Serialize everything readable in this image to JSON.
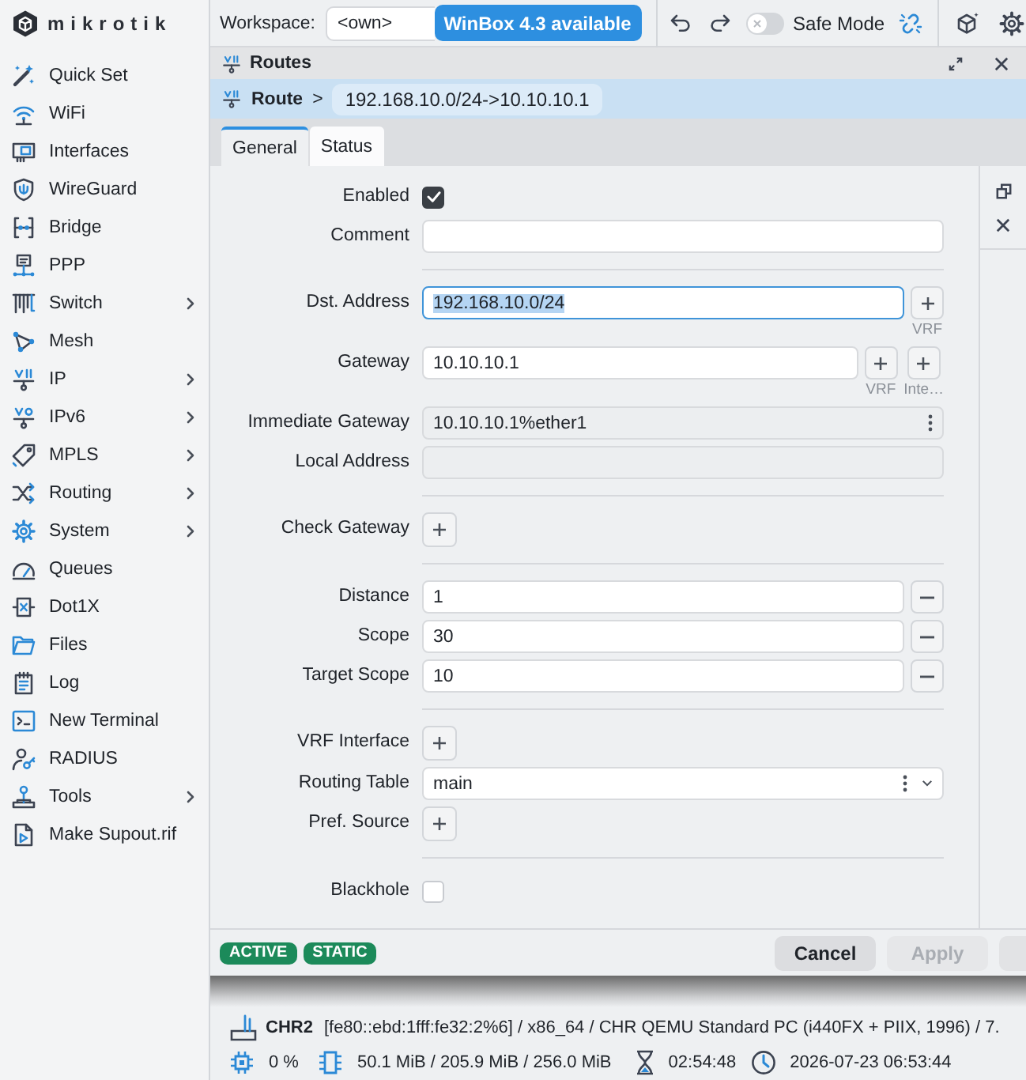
{
  "sidebar": {
    "logo": "mikrotik",
    "items": [
      {
        "label": "Quick Set",
        "submenu": false
      },
      {
        "label": "WiFi",
        "submenu": false
      },
      {
        "label": "Interfaces",
        "submenu": false
      },
      {
        "label": "WireGuard",
        "submenu": false
      },
      {
        "label": "Bridge",
        "submenu": false
      },
      {
        "label": "PPP",
        "submenu": false
      },
      {
        "label": "Switch",
        "submenu": true
      },
      {
        "label": "Mesh",
        "submenu": false
      },
      {
        "label": "IP",
        "submenu": true
      },
      {
        "label": "IPv6",
        "submenu": true
      },
      {
        "label": "MPLS",
        "submenu": true
      },
      {
        "label": "Routing",
        "submenu": true
      },
      {
        "label": "System",
        "submenu": true
      },
      {
        "label": "Queues",
        "submenu": false
      },
      {
        "label": "Dot1X",
        "submenu": false
      },
      {
        "label": "Files",
        "submenu": false
      },
      {
        "label": "Log",
        "submenu": false
      },
      {
        "label": "New Terminal",
        "submenu": false
      },
      {
        "label": "RADIUS",
        "submenu": false
      },
      {
        "label": "Tools",
        "submenu": true
      },
      {
        "label": "Make Supout.rif",
        "submenu": false
      }
    ]
  },
  "top_bar": {
    "workspace": {
      "label": "Workspace:",
      "value": "<own>"
    },
    "update_button": "WinBox 4.3 available",
    "safe_mode": {
      "label": "Safe Mode",
      "on": false
    }
  },
  "window": {
    "title": "Routes",
    "breadcrumb": {
      "section": "Route",
      "separator": ">",
      "item": "192.168.10.0/24->10.10.10.1"
    },
    "tabs": [
      {
        "label": "General",
        "selected": true
      },
      {
        "label": "Status",
        "selected": false
      }
    ],
    "form": {
      "rows": [
        {
          "kind": "checkbox",
          "label": "Enabled",
          "checked": true
        },
        {
          "kind": "text",
          "label": "Comment"
        },
        {
          "kind": "divider"
        },
        {
          "kind": "text",
          "label": "Dst. Address",
          "value": "192.168.10.0/24",
          "focused": true,
          "add_buttons": [
            "VRF"
          ]
        },
        {
          "kind": "text",
          "label": "Gateway",
          "value": "10.10.10.1",
          "add_buttons": [
            "VRF",
            "Inte…"
          ]
        },
        {
          "kind": "readonly",
          "label": "Immediate Gateway",
          "value": "10.10.10.1%ether1",
          "menu": true
        },
        {
          "kind": "readonly",
          "label": "Local Address"
        },
        {
          "kind": "divider"
        },
        {
          "kind": "add",
          "label": "Check Gateway"
        },
        {
          "kind": "divider"
        },
        {
          "kind": "text",
          "label": "Distance",
          "value": "1",
          "removable": true
        },
        {
          "kind": "text",
          "label": "Scope",
          "value": "30",
          "removable": true
        },
        {
          "kind": "text",
          "label": "Target Scope",
          "value": "10",
          "removable": true
        },
        {
          "kind": "divider"
        },
        {
          "kind": "add",
          "label": "VRF Interface"
        },
        {
          "kind": "select",
          "label": "Routing Table",
          "value": "main"
        },
        {
          "kind": "add",
          "label": "Pref. Source"
        },
        {
          "kind": "divider"
        },
        {
          "kind": "checkbox",
          "label": "Blackhole",
          "checked": false
        }
      ]
    },
    "footer": {
      "flags": [
        "ACTIVE",
        "STATIC"
      ],
      "buttons": [
        {
          "kind": "button",
          "label": "Cancel",
          "disabled": false
        },
        {
          "kind": "button",
          "label": "Apply",
          "disabled": true
        },
        {
          "kind": "cut_off"
        }
      ]
    }
  },
  "status_bar": {
    "device_name": "CHR2",
    "device_details": "[fe80::ebd:1fff:fe32:2%6] / x86_64 / CHR QEMU Standard PC (i440FX + PIIX, 1996) / 7.",
    "cpu": "0 %",
    "memory": "50.1 MiB / 205.9 MiB / 256.0 MiB",
    "uptime": "02:54:48",
    "clock": "2026-07-23 06:53:44"
  }
}
